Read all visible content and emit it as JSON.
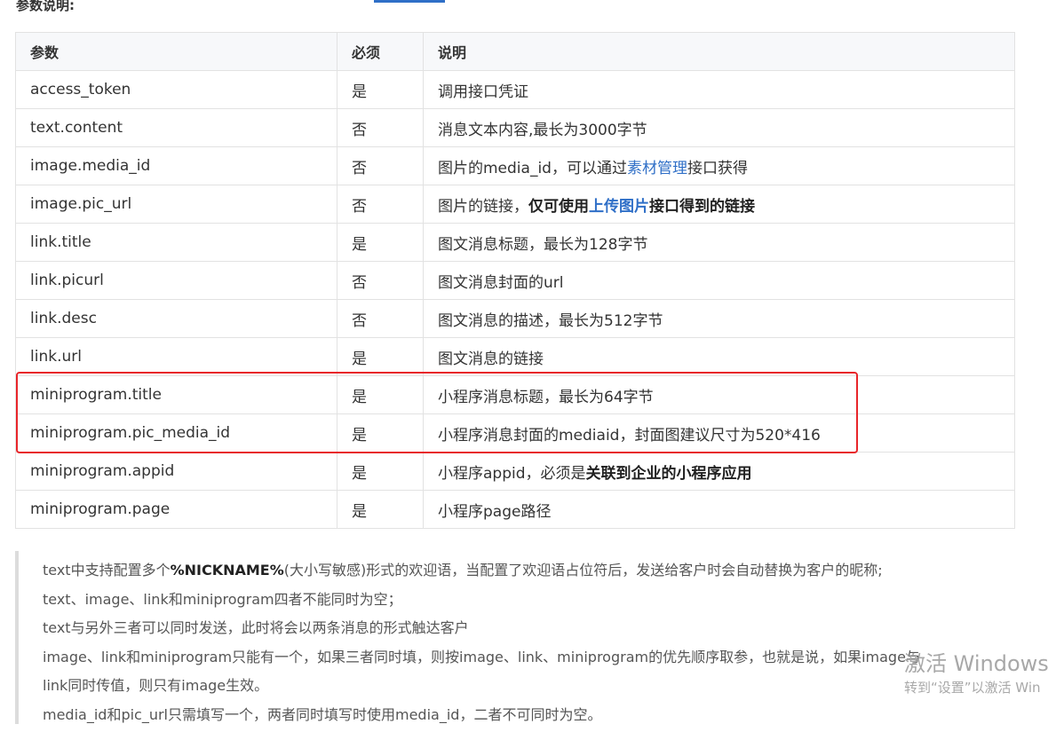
{
  "section_title": "参数说明:",
  "table": {
    "headers": [
      "参数",
      "必须",
      "说明"
    ],
    "rows": [
      {
        "param": "access_token",
        "required": "是",
        "desc": "调用接口凭证"
      },
      {
        "param": "text.content",
        "required": "否",
        "desc": "消息文本内容,最长为3000字节"
      },
      {
        "param": "image.media_id",
        "required": "否",
        "desc_pre": "图片的media_id，可以通过",
        "desc_link": "素材管理",
        "desc_post": "接口获得"
      },
      {
        "param": "image.pic_url",
        "required": "否",
        "desc_pre": "图片的链接，",
        "desc_bold1": "仅可使用",
        "desc_link": "上传图片",
        "desc_bold2": "接口得到的链接"
      },
      {
        "param": "link.title",
        "required": "是",
        "desc": "图文消息标题，最长为128字节"
      },
      {
        "param": "link.picurl",
        "required": "否",
        "desc": "图文消息封面的url"
      },
      {
        "param": "link.desc",
        "required": "否",
        "desc": "图文消息的描述，最长为512字节"
      },
      {
        "param": "link.url",
        "required": "是",
        "desc": "图文消息的链接"
      },
      {
        "param": "miniprogram.title",
        "required": "是",
        "desc": "小程序消息标题，最长为64字节"
      },
      {
        "param": "miniprogram.pic_media_id",
        "required": "是",
        "desc": "小程序消息封面的mediaid，封面图建议尺寸为520*416"
      },
      {
        "param": "miniprogram.appid",
        "required": "是",
        "desc_pre": "小程序appid，必须是",
        "desc_bold": "关联到企业的小程序应用"
      },
      {
        "param": "miniprogram.page",
        "required": "是",
        "desc": "小程序page路径"
      }
    ]
  },
  "notes": {
    "line1_pre": "text中支持配置多个",
    "line1_bold": "%NICKNAME%",
    "line1_post": "(大小写敏感)形式的欢迎语，当配置了欢迎语占位符后，发送给客户时会自动替换为客户的昵称;",
    "line2": "text、image、link和miniprogram四者不能同时为空；",
    "line3": "text与另外三者可以同时发送，此时将会以两条消息的形式触达客户",
    "line4": "image、link和miniprogram只能有一个，如果三者同时填，则按image、link、miniprogram的优先顺序取参，也就是说，如果image与",
    "line5": "link同时传值，则只有image生效。",
    "line6": "media_id和pic_url只需填写一个，两者同时填写时使用media_id，二者不可同时为空。"
  },
  "watermark": {
    "line1": "激活 Windows",
    "line2": "转到“设置”以激活 Win"
  },
  "colors": {
    "link": "#2f6fc7",
    "highlight_border": "#e8252a",
    "header_bg": "#f7f8fa"
  }
}
